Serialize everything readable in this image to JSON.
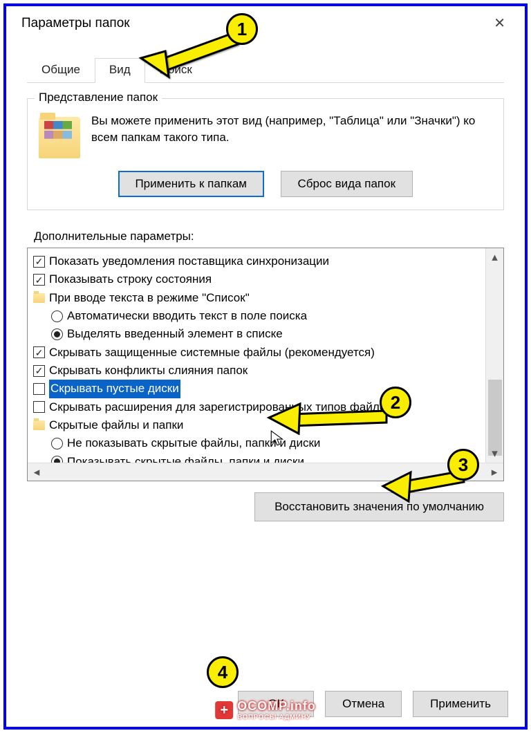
{
  "window": {
    "title": "Параметры папок"
  },
  "tabs": {
    "general": "Общие",
    "view": "Вид",
    "search": "Поиск"
  },
  "folderView": {
    "legend": "Представление папок",
    "text": "Вы можете применить этот вид (например, \"Таблица\" или \"Значки\") ко всем папкам такого типа.",
    "apply": "Применить к папкам",
    "reset": "Сброс вида папок"
  },
  "advanced": {
    "label": "Дополнительные параметры:",
    "items": {
      "sync_notify": "Показать уведомления поставщика синхронизации",
      "status_bar": "Показывать строку состояния",
      "typing_group": "При вводе текста в режиме \"Список\"",
      "typing_search": "Автоматически вводить текст в поле поиска",
      "typing_select": "Выделять введенный элемент в списке",
      "hide_protected": "Скрывать защищенные системные файлы (рекомендуется)",
      "hide_merge": "Скрывать конфликты слияния папок",
      "hide_empty": "Скрывать пустые диски",
      "hide_ext": "Скрывать расширения для зарегистрированных типов файло",
      "hidden_group": "Скрытые файлы и папки",
      "hidden_no": "Не показывать скрытые файлы, папки и диски",
      "hidden_yes": "Показывать скрытые файлы, папки и диски"
    }
  },
  "buttons": {
    "restore": "Восстановить значения по умолчанию",
    "ok": "ОК",
    "cancel": "Отмена",
    "apply": "Применить"
  },
  "annotations": {
    "n1": "1",
    "n2": "2",
    "n3": "3",
    "n4": "4"
  },
  "watermark": {
    "site": "OCOMP.info",
    "sub": "ВОПРОСЫ АДМИНУ"
  }
}
